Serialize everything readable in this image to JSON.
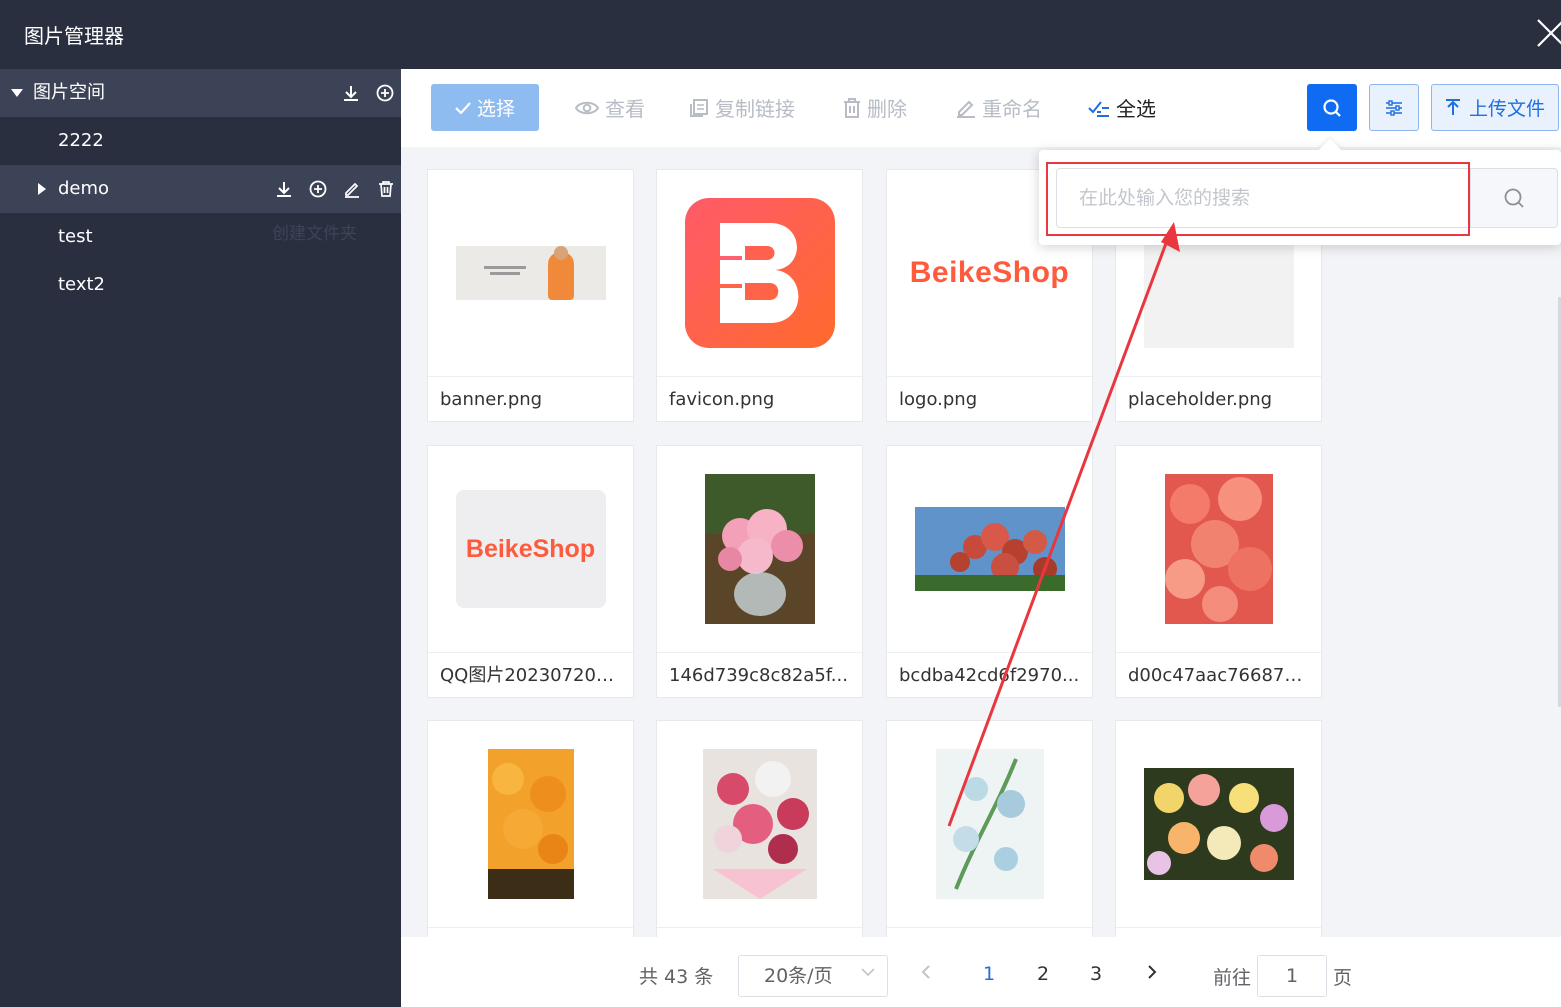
{
  "window": {
    "title": "图片管理器"
  },
  "sidebar": {
    "root": {
      "label": "图片空间"
    },
    "folders": [
      {
        "label": "2222"
      },
      {
        "label": "demo"
      },
      {
        "label": "test"
      },
      {
        "label": "text2"
      }
    ],
    "tooltip": "创建文件夹"
  },
  "toolbar": {
    "select_label": "选择",
    "view_label": "查看",
    "copy_link_label": "复制链接",
    "delete_label": "删除",
    "rename_label": "重命名",
    "select_all_label": "全选",
    "upload_label": "上传文件"
  },
  "search": {
    "placeholder": "在此处输入您的搜索",
    "value": ""
  },
  "images": [
    {
      "name": "banner.png"
    },
    {
      "name": "favicon.png"
    },
    {
      "name": "logo.png"
    },
    {
      "name": "placeholder.png"
    },
    {
      "name": "QQ图片202307201..."
    },
    {
      "name": "146d739c8c82a5f..."
    },
    {
      "name": "bcdba42cd6f2970..."
    },
    {
      "name": "d00c47aac76687e..."
    },
    {
      "name": ""
    },
    {
      "name": ""
    },
    {
      "name": ""
    },
    {
      "name": ""
    }
  ],
  "logo_text": {
    "beike": "BeikeShop",
    "placeholder": "beikeshop"
  },
  "pagination": {
    "total": "共 43 条",
    "page_size": "20条/页",
    "pages": [
      "1",
      "2",
      "3"
    ],
    "current": "1",
    "goto_label": "前往",
    "goto_value": "1",
    "goto_unit": "页"
  },
  "colors": {
    "sidebar_bg": "#2a2f40",
    "accent": "#0f6cf2",
    "annotation": "#e8373f"
  }
}
